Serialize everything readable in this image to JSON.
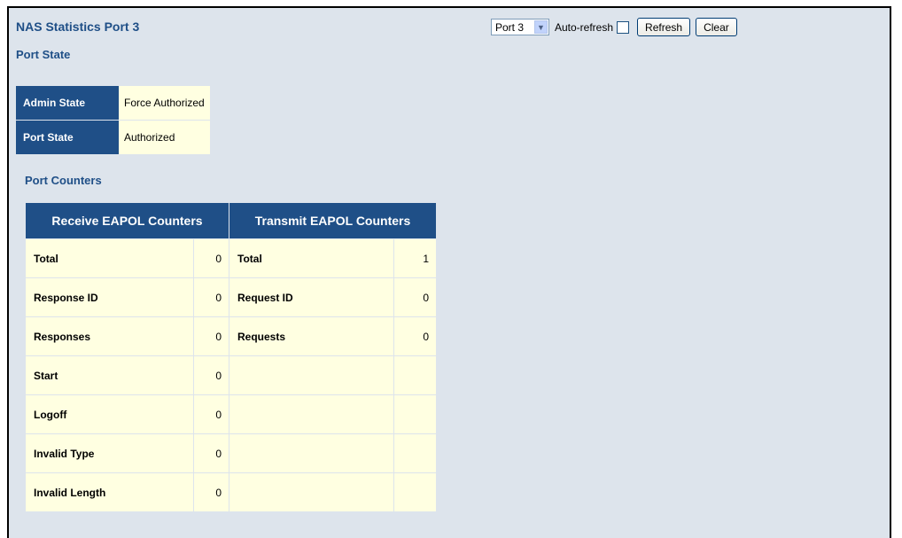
{
  "page": {
    "title": "NAS Statistics  Port 3",
    "port_state_heading": "Port State",
    "port_counters_heading": "Port Counters"
  },
  "controls": {
    "port_select": "Port 3",
    "auto_refresh_label": "Auto-refresh",
    "refresh_label": "Refresh",
    "clear_label": "Clear"
  },
  "port_state": {
    "admin_state_label": "Admin State",
    "admin_state_value": "Force Authorized",
    "port_state_label": "Port State",
    "port_state_value": "Authorized"
  },
  "counters": {
    "receive_header": "Receive EAPOL Counters",
    "transmit_header": "Transmit EAPOL Counters",
    "rows": [
      {
        "rx_name": "Total",
        "rx_value": "0",
        "tx_name": "Total",
        "tx_value": "1"
      },
      {
        "rx_name": "Response ID",
        "rx_value": "0",
        "tx_name": "Request ID",
        "tx_value": "0"
      },
      {
        "rx_name": "Responses",
        "rx_value": "0",
        "tx_name": "Requests",
        "tx_value": "0"
      },
      {
        "rx_name": "Start",
        "rx_value": "0",
        "tx_name": "",
        "tx_value": ""
      },
      {
        "rx_name": "Logoff",
        "rx_value": "0",
        "tx_name": "",
        "tx_value": ""
      },
      {
        "rx_name": "Invalid Type",
        "rx_value": "0",
        "tx_name": "",
        "tx_value": ""
      },
      {
        "rx_name": "Invalid Length",
        "rx_value": "0",
        "tx_name": "",
        "tx_value": ""
      }
    ]
  },
  "colors": {
    "header_bg": "#1f4f87",
    "cell_bg": "#ffffe1",
    "page_bg": "#dde4ec"
  }
}
